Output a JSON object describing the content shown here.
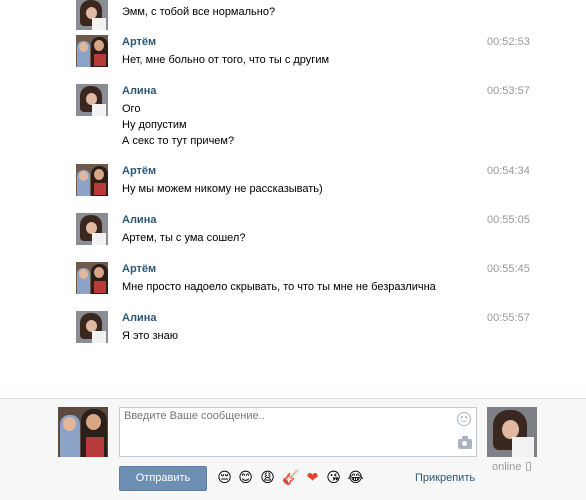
{
  "messages": [
    {
      "author": "",
      "time": "",
      "lines": [
        "Эмм, с тобой все нормально?"
      ],
      "avatar": "alina"
    },
    {
      "author": "Артём",
      "time": "00:52:53",
      "lines": [
        "Нет, мне больно от того, что ты с другим"
      ],
      "avatar": "artem"
    },
    {
      "author": "Алина",
      "time": "00:53:57",
      "lines": [
        "Ого",
        "Ну допустим",
        "А секс то тут причем?"
      ],
      "avatar": "alina"
    },
    {
      "author": "Артём",
      "time": "00:54:34",
      "lines": [
        "Ну мы можем никому не рассказывать)"
      ],
      "avatar": "artem"
    },
    {
      "author": "Алина",
      "time": "00:55:05",
      "lines": [
        "Артем, ты с ума сошел?"
      ],
      "avatar": "alina"
    },
    {
      "author": "Артём",
      "time": "00:55:45",
      "lines": [
        "Мне просто надоело скрывать, то что ты мне не безразлична"
      ],
      "avatar": "artem"
    },
    {
      "author": "Алина",
      "time": "00:55:57",
      "lines": [
        "Я это знаю"
      ],
      "avatar": "alina"
    }
  ],
  "compose": {
    "placeholder": "Введите Ваше сообщение..",
    "send_label": "Отправить",
    "attach_label": "Прикрепить",
    "online_label": "online",
    "emojis": [
      "😔",
      "😊",
      "😩",
      "🎸",
      "❤",
      "😘",
      "😂"
    ]
  },
  "colors": {
    "author": "#2b587a",
    "time": "#999999",
    "send_button": "#6d8fb3",
    "panel_bg": "#f7f7f7"
  }
}
